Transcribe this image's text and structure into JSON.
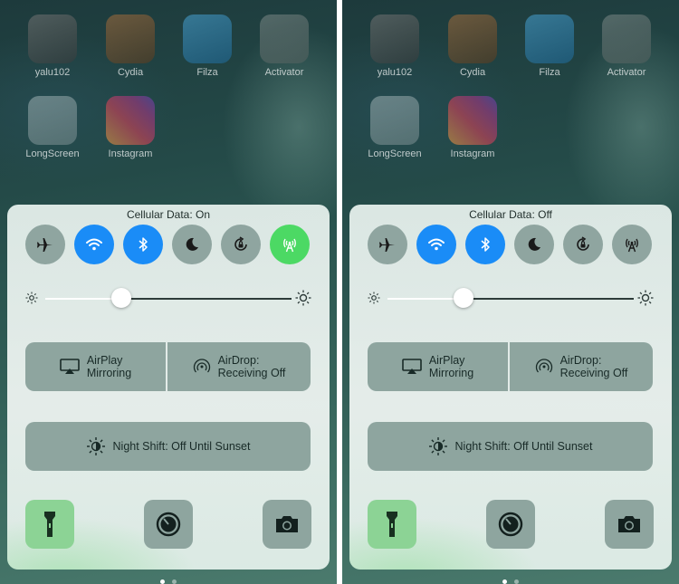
{
  "apps": {
    "row1": [
      {
        "label": "yalu102",
        "icon": "yalu102-app-icon"
      },
      {
        "label": "Cydia",
        "icon": "cydia-app-icon"
      },
      {
        "label": "Filza",
        "icon": "filza-app-icon"
      },
      {
        "label": "Activator",
        "icon": "activator-app-icon"
      }
    ],
    "row2": [
      {
        "label": "LongScreen",
        "icon": "longscreen-app-icon"
      },
      {
        "label": "Instagram",
        "icon": "instagram-app-icon"
      }
    ]
  },
  "left": {
    "cellular_status": "Cellular Data: On",
    "toggles": {
      "airplane": "off",
      "wifi": "on",
      "bluetooth": "on",
      "do_not_disturb": "off",
      "rotation_lock": "off",
      "cellular": "on"
    },
    "brightness": 0.31
  },
  "right": {
    "cellular_status": "Cellular Data: Off",
    "toggles": {
      "airplane": "off",
      "wifi": "on",
      "bluetooth": "on",
      "do_not_disturb": "off",
      "rotation_lock": "off",
      "cellular": "off"
    },
    "brightness": 0.31
  },
  "controls": {
    "airplay_line1": "AirPlay",
    "airplay_line2": "Mirroring",
    "airdrop_line1": "AirDrop:",
    "airdrop_line2": "Receiving Off",
    "night_shift": "Night Shift: Off Until Sunset"
  },
  "page_indicator": {
    "pages": 2,
    "current": 1
  },
  "colors": {
    "toggle_blue": "#1a8cf7",
    "toggle_green": "#4cd964",
    "toggle_off": "#8fa5a0"
  }
}
